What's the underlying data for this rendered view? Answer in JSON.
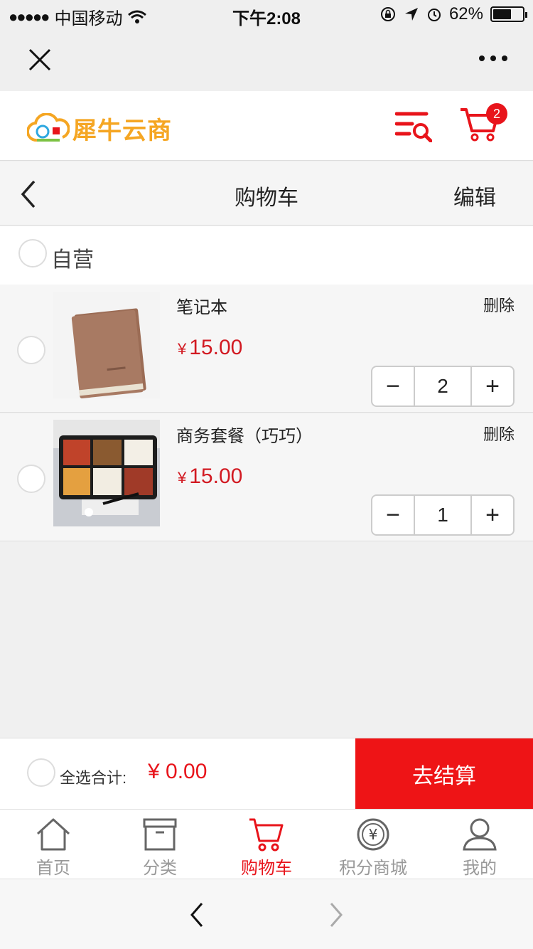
{
  "status_bar": {
    "carrier": "中国移动",
    "time": "下午2:08",
    "battery": "62%"
  },
  "header": {
    "logo_text": "犀牛云商",
    "cart_badge": "2"
  },
  "title_bar": {
    "title": "购物车",
    "edit_label": "编辑"
  },
  "store": {
    "name": "自营"
  },
  "items": [
    {
      "name": "笔记本",
      "delete_label": "删除",
      "currency": "¥",
      "price": "15.00",
      "qty": "2",
      "image": "brown-notebook"
    },
    {
      "name": "商务套餐（巧巧）",
      "delete_label": "删除",
      "currency": "¥",
      "price": "15.00",
      "qty": "1",
      "image": "lunch-box"
    }
  ],
  "stepper": {
    "minus": "−",
    "plus": "+"
  },
  "checkout": {
    "select_all_label": "全选合计:",
    "total": "¥  0.00",
    "button_label": "去结算"
  },
  "tabbar": [
    {
      "label": "首页",
      "icon": "home-icon",
      "active": false
    },
    {
      "label": "分类",
      "icon": "category-box-icon",
      "active": false
    },
    {
      "label": "购物车",
      "icon": "cart-icon",
      "active": true
    },
    {
      "label": "积分商城",
      "icon": "points-coin-icon",
      "active": false
    },
    {
      "label": "我的",
      "icon": "user-icon",
      "active": false
    }
  ],
  "colors": {
    "accent": "#e8141b",
    "price": "#d21a22",
    "checkout_button": "#ee1416"
  }
}
